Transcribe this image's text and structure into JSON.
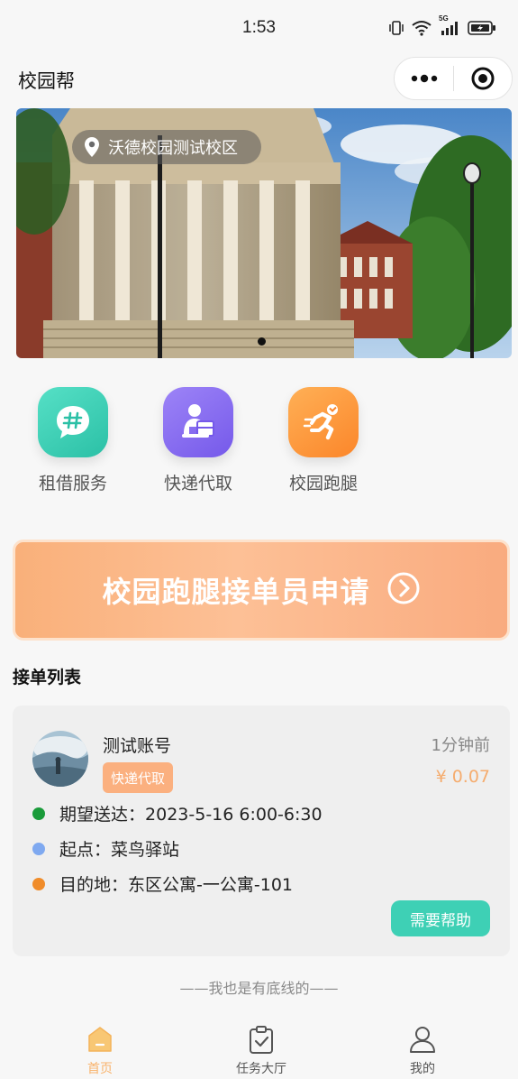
{
  "status_bar": {
    "time": "1:53",
    "network_badge": "5G",
    "icons": [
      "vibrate-icon",
      "wifi-icon",
      "cellular-signal-icon",
      "battery-charging-icon"
    ]
  },
  "nav": {
    "title": "校园帮",
    "capsule_icons": [
      "more-dots-icon",
      "target-circle-icon"
    ]
  },
  "banner": {
    "location": "沃德校园测试校区",
    "slide_count": 1,
    "active_slide": 1
  },
  "services": [
    {
      "label": "租借服务",
      "icon": "hashtag-chat-icon",
      "color": "#3ed0b5"
    },
    {
      "label": "快递代取",
      "icon": "courier-package-icon",
      "color": "#8b6ff2"
    },
    {
      "label": "校园跑腿",
      "icon": "running-person-icon",
      "color": "#fb962f"
    }
  ],
  "apply_banner": {
    "text": "校园跑腿接单员申请",
    "icon": "chevron-right-circle-icon"
  },
  "orders": {
    "title": "接单列表",
    "items": [
      {
        "username": "测试账号",
        "type": "快递代取",
        "time_ago": "1分钟前",
        "price": "¥ 0.07",
        "expected_label": "期望送达：",
        "expected_value": "2023-5-16 6:00-6:30",
        "origin_label": "起点：",
        "origin_value": "菜鸟驿站",
        "destination_label": "目的地：",
        "destination_value": "东区公寓-一公寓-101",
        "help_label": "需要帮助"
      }
    ]
  },
  "footer_note": "——我也是有底线的——",
  "tab_bar": {
    "tabs": [
      {
        "label": "首页",
        "icon": "home-icon",
        "active": true
      },
      {
        "label": "任务大厅",
        "icon": "clipboard-check-icon",
        "active": false
      },
      {
        "label": "我的",
        "icon": "user-icon",
        "active": false
      }
    ]
  },
  "colors": {
    "accent_orange": "#f8b36c",
    "teal": "#3ed0b5",
    "purple": "#8b6ff2",
    "orange": "#fb962f",
    "dot_green": "#1a9b3a",
    "dot_blue": "#7fa9f0",
    "dot_orange": "#f08c2a"
  }
}
